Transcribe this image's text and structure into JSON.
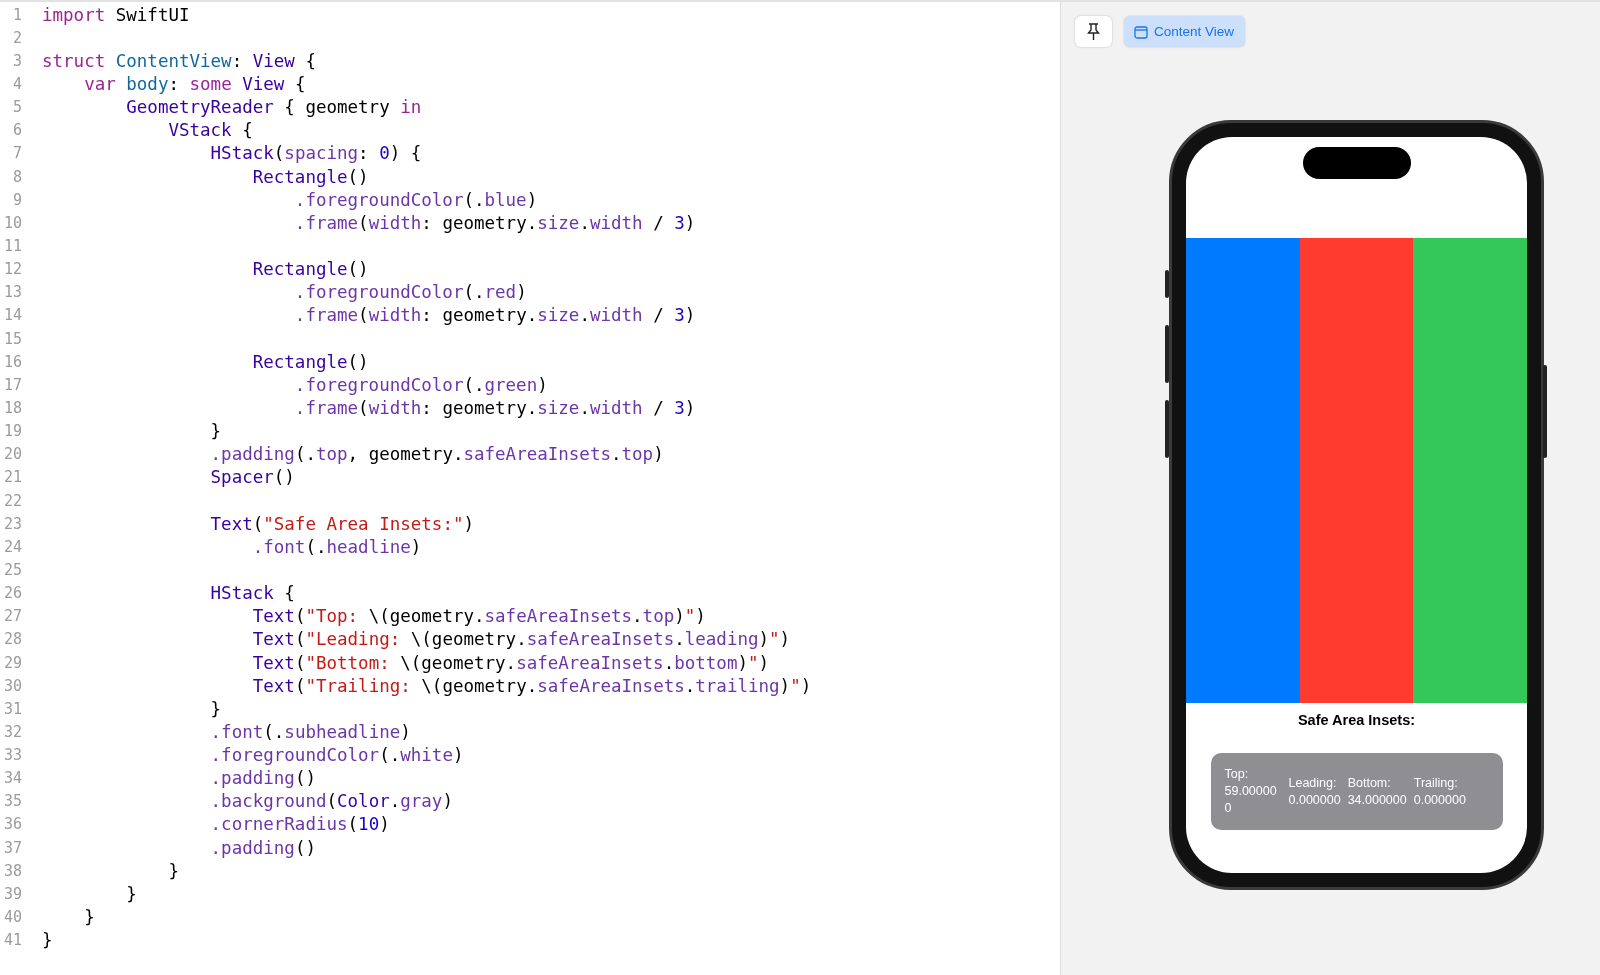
{
  "editor": {
    "lines": [
      {
        "number": "1",
        "tokens": [
          {
            "kind": "keyword",
            "text": "import"
          },
          {
            "kind": "plain",
            "text": " SwiftUI"
          }
        ]
      },
      {
        "number": "2"
      },
      {
        "number": "3",
        "tokens": [
          {
            "kind": "keyword",
            "text": "struct"
          },
          {
            "kind": "declaration",
            "text": " ContentView"
          },
          {
            "kind": "plain",
            "text": ": "
          },
          {
            "kind": "type",
            "text": "View"
          },
          {
            "kind": "plain",
            "text": " {"
          }
        ]
      },
      {
        "number": "4",
        "tokens": [
          {
            "kind": "keyword",
            "text": "    var"
          },
          {
            "kind": "declaration",
            "text": " body"
          },
          {
            "kind": "plain",
            "text": ": "
          },
          {
            "kind": "keyword",
            "text": "some"
          },
          {
            "kind": "type",
            "text": " View"
          },
          {
            "kind": "plain",
            "text": " {"
          }
        ]
      },
      {
        "number": "5",
        "tokens": [
          {
            "kind": "type",
            "text": "        GeometryReader"
          },
          {
            "kind": "plain",
            "text": " { geometry "
          },
          {
            "kind": "keyword",
            "text": "in"
          }
        ]
      },
      {
        "number": "6",
        "tokens": [
          {
            "kind": "type",
            "text": "            VStack"
          },
          {
            "kind": "plain",
            "text": " {"
          }
        ]
      },
      {
        "number": "7",
        "tokens": [
          {
            "kind": "type",
            "text": "                HStack"
          },
          {
            "kind": "plain",
            "text": "("
          },
          {
            "kind": "member",
            "text": "spacing"
          },
          {
            "kind": "plain",
            "text": ": "
          },
          {
            "kind": "number",
            "text": "0"
          },
          {
            "kind": "plain",
            "text": ") {"
          }
        ]
      },
      {
        "number": "8",
        "tokens": [
          {
            "kind": "type",
            "text": "                    Rectangle"
          },
          {
            "kind": "plain",
            "text": "()"
          }
        ]
      },
      {
        "number": "9",
        "tokens": [
          {
            "kind": "member",
            "text": "                        .foregroundColor"
          },
          {
            "kind": "plain",
            "text": "(."
          },
          {
            "kind": "member",
            "text": "blue"
          },
          {
            "kind": "plain",
            "text": ")"
          }
        ]
      },
      {
        "number": "10",
        "tokens": [
          {
            "kind": "member",
            "text": "                        .frame"
          },
          {
            "kind": "plain",
            "text": "("
          },
          {
            "kind": "member",
            "text": "width"
          },
          {
            "kind": "plain",
            "text": ": geometry."
          },
          {
            "kind": "member",
            "text": "size"
          },
          {
            "kind": "plain",
            "text": "."
          },
          {
            "kind": "member",
            "text": "width"
          },
          {
            "kind": "plain",
            "text": " / "
          },
          {
            "kind": "number",
            "text": "3"
          },
          {
            "kind": "plain",
            "text": ")"
          }
        ]
      },
      {
        "number": "11"
      },
      {
        "number": "12",
        "tokens": [
          {
            "kind": "type",
            "text": "                    Rectangle"
          },
          {
            "kind": "plain",
            "text": "()"
          }
        ]
      },
      {
        "number": "13",
        "tokens": [
          {
            "kind": "member",
            "text": "                        .foregroundColor"
          },
          {
            "kind": "plain",
            "text": "(."
          },
          {
            "kind": "member",
            "text": "red"
          },
          {
            "kind": "plain",
            "text": ")"
          }
        ]
      },
      {
        "number": "14",
        "tokens": [
          {
            "kind": "member",
            "text": "                        .frame"
          },
          {
            "kind": "plain",
            "text": "("
          },
          {
            "kind": "member",
            "text": "width"
          },
          {
            "kind": "plain",
            "text": ": geometry."
          },
          {
            "kind": "member",
            "text": "size"
          },
          {
            "kind": "plain",
            "text": "."
          },
          {
            "kind": "member",
            "text": "width"
          },
          {
            "kind": "plain",
            "text": " / "
          },
          {
            "kind": "number",
            "text": "3"
          },
          {
            "kind": "plain",
            "text": ")"
          }
        ]
      },
      {
        "number": "15"
      },
      {
        "number": "16",
        "tokens": [
          {
            "kind": "type",
            "text": "                    Rectangle"
          },
          {
            "kind": "plain",
            "text": "()"
          }
        ]
      },
      {
        "number": "17",
        "tokens": [
          {
            "kind": "member",
            "text": "                        .foregroundColor"
          },
          {
            "kind": "plain",
            "text": "(."
          },
          {
            "kind": "member",
            "text": "green"
          },
          {
            "kind": "plain",
            "text": ")"
          }
        ]
      },
      {
        "number": "18",
        "tokens": [
          {
            "kind": "member",
            "text": "                        .frame"
          },
          {
            "kind": "plain",
            "text": "("
          },
          {
            "kind": "member",
            "text": "width"
          },
          {
            "kind": "plain",
            "text": ": geometry."
          },
          {
            "kind": "member",
            "text": "size"
          },
          {
            "kind": "plain",
            "text": "."
          },
          {
            "kind": "member",
            "text": "width"
          },
          {
            "kind": "plain",
            "text": " / "
          },
          {
            "kind": "number",
            "text": "3"
          },
          {
            "kind": "plain",
            "text": ")"
          }
        ]
      },
      {
        "number": "19",
        "tokens": [
          {
            "kind": "plain",
            "text": "                }"
          }
        ]
      },
      {
        "number": "20",
        "tokens": [
          {
            "kind": "member",
            "text": "                .padding"
          },
          {
            "kind": "plain",
            "text": "(."
          },
          {
            "kind": "member",
            "text": "top"
          },
          {
            "kind": "plain",
            "text": ", geometry."
          },
          {
            "kind": "member",
            "text": "safeAreaInsets"
          },
          {
            "kind": "plain",
            "text": "."
          },
          {
            "kind": "member",
            "text": "top"
          },
          {
            "kind": "plain",
            "text": ")"
          }
        ]
      },
      {
        "number": "21",
        "tokens": [
          {
            "kind": "type",
            "text": "                Spacer"
          },
          {
            "kind": "plain",
            "text": "()"
          }
        ]
      },
      {
        "number": "22"
      },
      {
        "number": "23",
        "tokens": [
          {
            "kind": "type",
            "text": "                Text"
          },
          {
            "kind": "plain",
            "text": "("
          },
          {
            "kind": "string",
            "text": "\"Safe Area Insets:\""
          },
          {
            "kind": "plain",
            "text": ")"
          }
        ]
      },
      {
        "number": "24",
        "tokens": [
          {
            "kind": "member",
            "text": "                    .font"
          },
          {
            "kind": "plain",
            "text": "(."
          },
          {
            "kind": "member",
            "text": "headline"
          },
          {
            "kind": "plain",
            "text": ")"
          }
        ]
      },
      {
        "number": "25"
      },
      {
        "number": "26",
        "tokens": [
          {
            "kind": "type",
            "text": "                HStack"
          },
          {
            "kind": "plain",
            "text": " {"
          }
        ]
      },
      {
        "number": "27",
        "tokens": [
          {
            "kind": "type",
            "text": "                    Text"
          },
          {
            "kind": "plain",
            "text": "("
          },
          {
            "kind": "string",
            "text": "\"Top: "
          },
          {
            "kind": "plain",
            "text": "\\(geometry."
          },
          {
            "kind": "member",
            "text": "safeAreaInsets"
          },
          {
            "kind": "plain",
            "text": "."
          },
          {
            "kind": "member",
            "text": "top"
          },
          {
            "kind": "plain",
            "text": ")"
          },
          {
            "kind": "string",
            "text": "\""
          },
          {
            "kind": "plain",
            "text": ")"
          }
        ]
      },
      {
        "number": "28",
        "tokens": [
          {
            "kind": "type",
            "text": "                    Text"
          },
          {
            "kind": "plain",
            "text": "("
          },
          {
            "kind": "string",
            "text": "\"Leading: "
          },
          {
            "kind": "plain",
            "text": "\\(geometry."
          },
          {
            "kind": "member",
            "text": "safeAreaInsets"
          },
          {
            "kind": "plain",
            "text": "."
          },
          {
            "kind": "member",
            "text": "leading"
          },
          {
            "kind": "plain",
            "text": ")"
          },
          {
            "kind": "string",
            "text": "\""
          },
          {
            "kind": "plain",
            "text": ")"
          }
        ]
      },
      {
        "number": "29",
        "tokens": [
          {
            "kind": "type",
            "text": "                    Text"
          },
          {
            "kind": "plain",
            "text": "("
          },
          {
            "kind": "string",
            "text": "\"Bottom: "
          },
          {
            "kind": "plain",
            "text": "\\(geometry."
          },
          {
            "kind": "member",
            "text": "safeAreaInsets"
          },
          {
            "kind": "plain",
            "text": "."
          },
          {
            "kind": "member",
            "text": "bottom"
          },
          {
            "kind": "plain",
            "text": ")"
          },
          {
            "kind": "string",
            "text": "\""
          },
          {
            "kind": "plain",
            "text": ")"
          }
        ]
      },
      {
        "number": "30",
        "tokens": [
          {
            "kind": "type",
            "text": "                    Text"
          },
          {
            "kind": "plain",
            "text": "("
          },
          {
            "kind": "string",
            "text": "\"Trailing: "
          },
          {
            "kind": "plain",
            "text": "\\(geometry."
          },
          {
            "kind": "member",
            "text": "safeAreaInsets"
          },
          {
            "kind": "plain",
            "text": "."
          },
          {
            "kind": "member",
            "text": "trailing"
          },
          {
            "kind": "plain",
            "text": ")"
          },
          {
            "kind": "string",
            "text": "\""
          },
          {
            "kind": "plain",
            "text": ")"
          }
        ]
      },
      {
        "number": "31",
        "tokens": [
          {
            "kind": "plain",
            "text": "                }"
          }
        ]
      },
      {
        "number": "32",
        "tokens": [
          {
            "kind": "member",
            "text": "                .font"
          },
          {
            "kind": "plain",
            "text": "(."
          },
          {
            "kind": "member",
            "text": "subheadline"
          },
          {
            "kind": "plain",
            "text": ")"
          }
        ]
      },
      {
        "number": "33",
        "tokens": [
          {
            "kind": "member",
            "text": "                .foregroundColor"
          },
          {
            "kind": "plain",
            "text": "(."
          },
          {
            "kind": "member",
            "text": "white"
          },
          {
            "kind": "plain",
            "text": ")"
          }
        ]
      },
      {
        "number": "34",
        "tokens": [
          {
            "kind": "member",
            "text": "                .padding"
          },
          {
            "kind": "plain",
            "text": "()"
          }
        ]
      },
      {
        "number": "35",
        "tokens": [
          {
            "kind": "member",
            "text": "                .background"
          },
          {
            "kind": "plain",
            "text": "("
          },
          {
            "kind": "type",
            "text": "Color"
          },
          {
            "kind": "plain",
            "text": "."
          },
          {
            "kind": "member",
            "text": "gray"
          },
          {
            "kind": "plain",
            "text": ")"
          }
        ]
      },
      {
        "number": "36",
        "tokens": [
          {
            "kind": "member",
            "text": "                .cornerRadius"
          },
          {
            "kind": "plain",
            "text": "("
          },
          {
            "kind": "number",
            "text": "10"
          },
          {
            "kind": "plain",
            "text": ")"
          }
        ]
      },
      {
        "number": "37",
        "tokens": [
          {
            "kind": "member",
            "text": "                .padding"
          },
          {
            "kind": "plain",
            "text": "()"
          }
        ]
      },
      {
        "number": "38",
        "tokens": [
          {
            "kind": "plain",
            "text": "            }"
          }
        ]
      },
      {
        "number": "39",
        "tokens": [
          {
            "kind": "plain",
            "text": "        }"
          }
        ]
      },
      {
        "number": "40",
        "tokens": [
          {
            "kind": "plain",
            "text": "    }"
          }
        ]
      },
      {
        "number": "41",
        "tokens": [
          {
            "kind": "plain",
            "text": "}"
          }
        ]
      }
    ]
  },
  "preview": {
    "tab": {
      "label": "Content View",
      "selected": true
    },
    "phone": {
      "stripes": [
        {
          "color": "#007aff"
        },
        {
          "color": "#ff3b30"
        },
        {
          "color": "#34c759"
        }
      ],
      "insets_title": "Safe Area Insets:",
      "insets": [
        "Top: 59.000000",
        "Leading: 0.000000",
        "Bottom: 34.000000",
        "Trailing: 0.000000"
      ]
    }
  }
}
